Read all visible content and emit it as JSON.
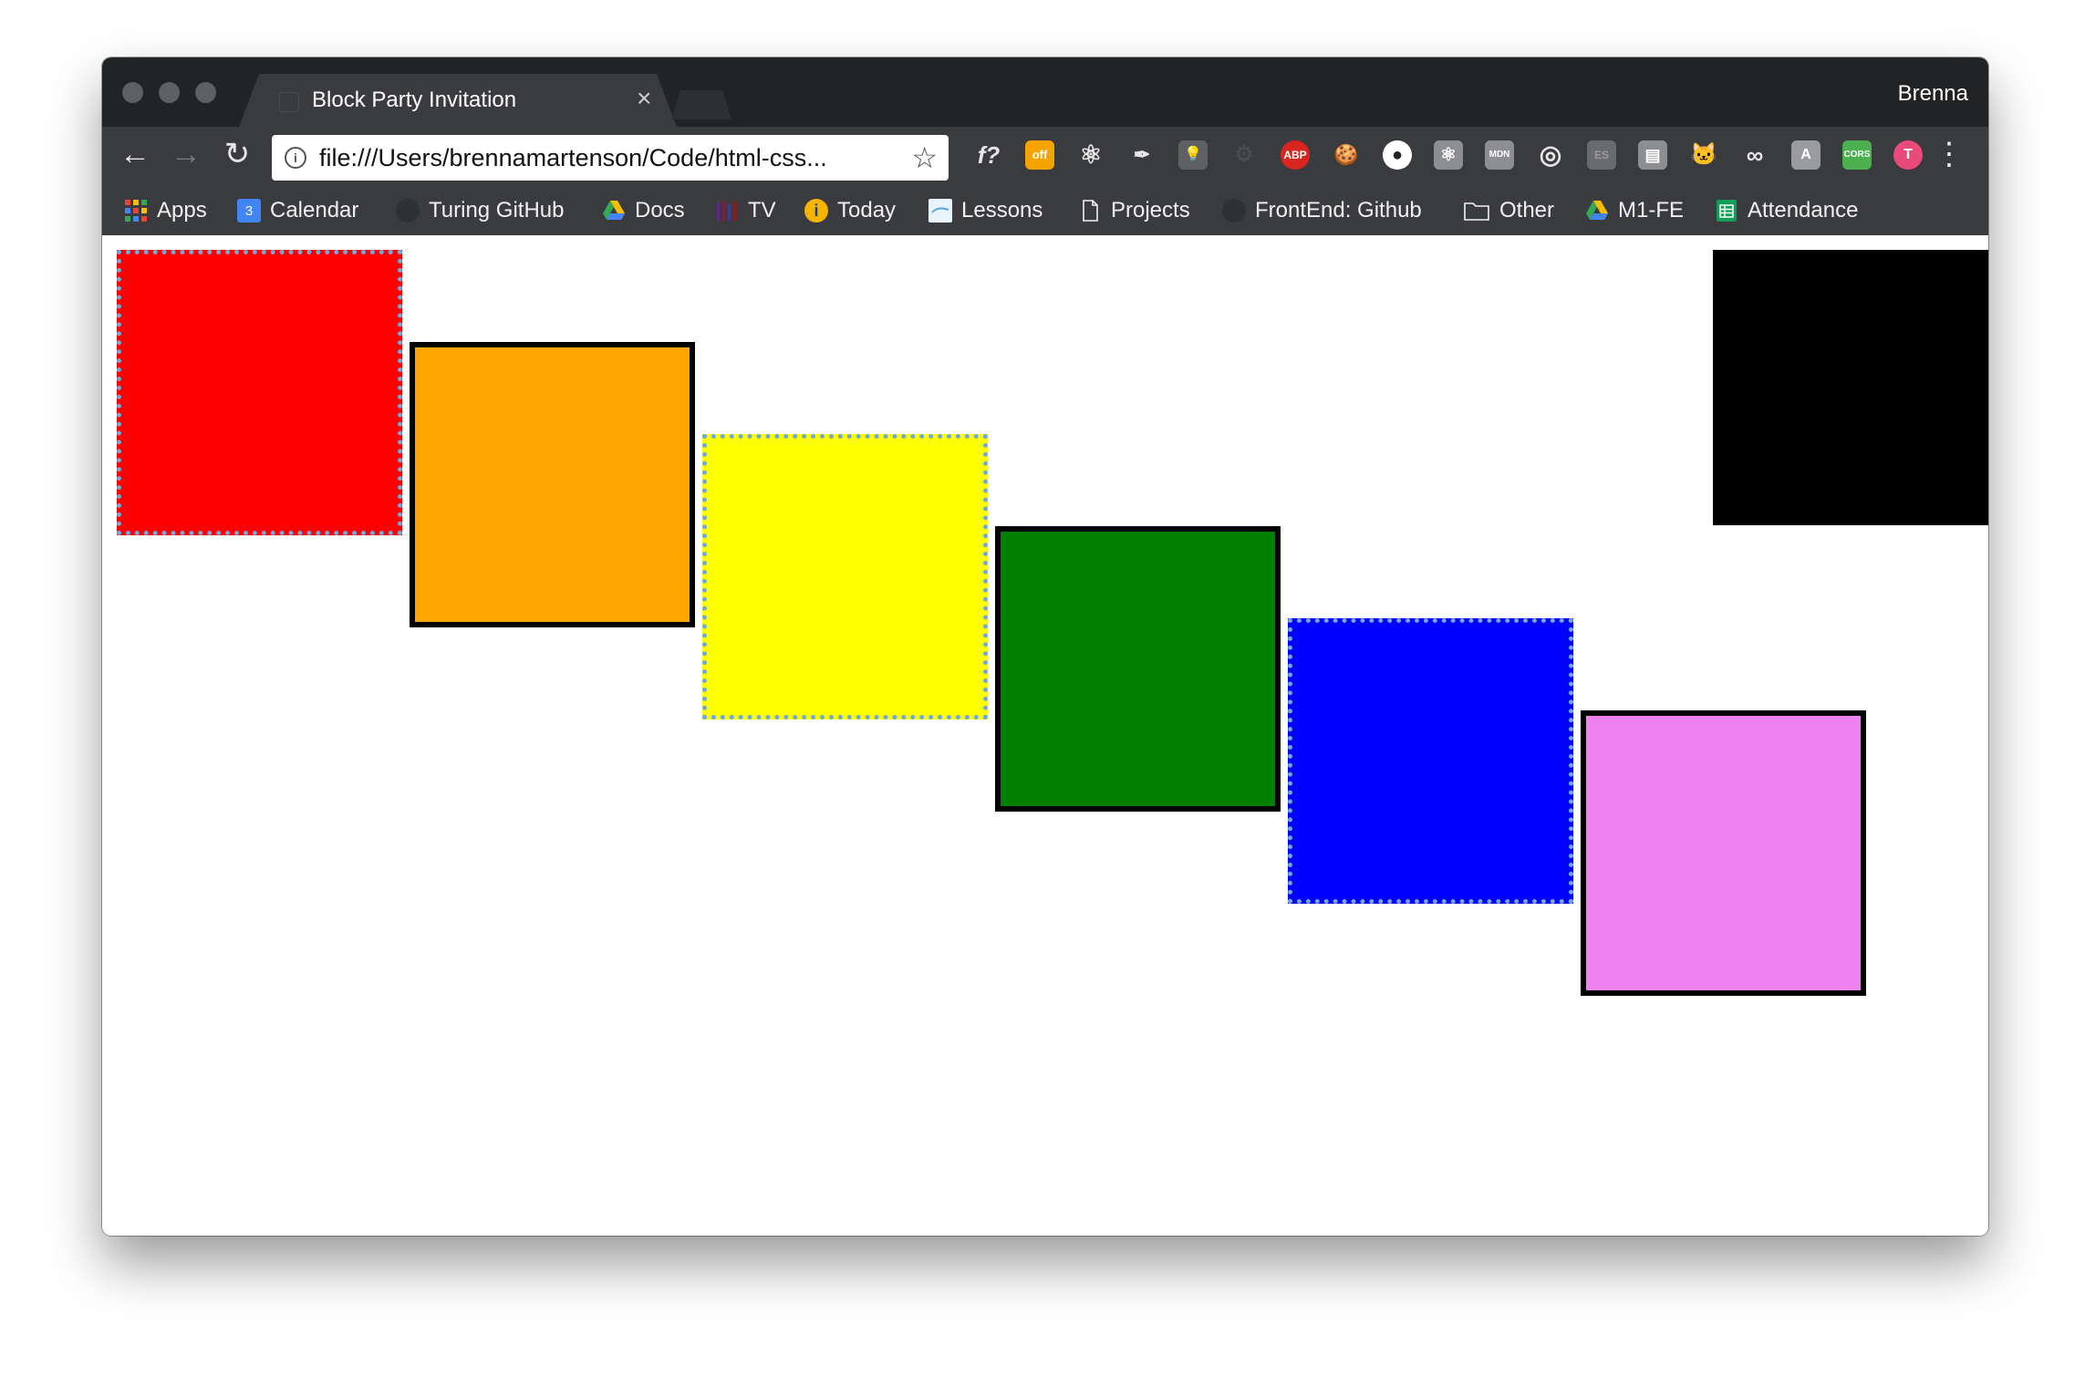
{
  "browser": {
    "tab_title": "Block Party Invitation",
    "profile_name": "Brenna",
    "url": "file:///Users/brennamartenson/Code/html-css...",
    "extensions": [
      {
        "name": "fx-icon",
        "text": "f?"
      },
      {
        "name": "off-badge-icon",
        "text": "off"
      },
      {
        "name": "react-icon",
        "text": "⚛"
      },
      {
        "name": "eyedropper-icon",
        "text": "✒"
      },
      {
        "name": "lightbulb-icon",
        "text": "💡"
      },
      {
        "name": "gear-icon",
        "text": "⚙"
      },
      {
        "name": "adblock-icon",
        "text": "ABP"
      },
      {
        "name": "cookie-icon",
        "text": "🍪"
      },
      {
        "name": "circle-icon",
        "text": "●"
      },
      {
        "name": "react-devtools-icon",
        "text": "⚛"
      },
      {
        "name": "mdn-icon",
        "text": "MDN"
      },
      {
        "name": "target-icon",
        "text": "◎"
      },
      {
        "name": "es-icon",
        "text": "ES"
      },
      {
        "name": "pages-icon",
        "text": "▤"
      },
      {
        "name": "cat-icon",
        "text": "🐱"
      },
      {
        "name": "link-icon",
        "text": "∞"
      },
      {
        "name": "font-icon",
        "text": "A"
      },
      {
        "name": "cors-icon",
        "text": "CORS"
      },
      {
        "name": "tampermonkey-icon",
        "text": "T"
      }
    ]
  },
  "bookmarks": [
    {
      "name": "apps",
      "label": "Apps"
    },
    {
      "name": "calendar",
      "label": "Calendar",
      "badge": "3"
    },
    {
      "name": "turing-github",
      "label": "Turing GitHub"
    },
    {
      "name": "docs",
      "label": "Docs"
    },
    {
      "name": "tv",
      "label": "TV"
    },
    {
      "name": "today",
      "label": "Today"
    },
    {
      "name": "lessons",
      "label": "Lessons"
    },
    {
      "name": "projects",
      "label": "Projects"
    },
    {
      "name": "frontend-github",
      "label": "FrontEnd: Github"
    },
    {
      "name": "other",
      "label": "Other"
    },
    {
      "name": "m1-fe",
      "label": "M1-FE"
    },
    {
      "name": "attendance",
      "label": "Attendance"
    }
  ],
  "blocks": [
    {
      "name": "red-block",
      "color": "#ff0000",
      "border": "dotted"
    },
    {
      "name": "orange-block",
      "color": "#ffa500",
      "border": "solid"
    },
    {
      "name": "yellow-block",
      "color": "#ffff00",
      "border": "dotted"
    },
    {
      "name": "green-block",
      "color": "#008000",
      "border": "solid"
    },
    {
      "name": "blue-block",
      "color": "#0000ff",
      "border": "dotted"
    },
    {
      "name": "violet-block",
      "color": "#ee82ee",
      "border": "solid"
    },
    {
      "name": "black-block",
      "color": "#000000",
      "border": "none"
    }
  ]
}
